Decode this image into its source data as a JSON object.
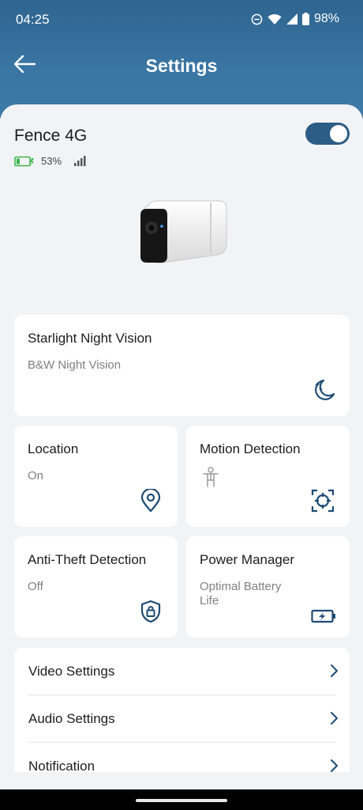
{
  "status_bar": {
    "time": "04:25",
    "battery": "98%"
  },
  "header": {
    "title": "Settings",
    "back_icon": "arrow-left-icon"
  },
  "device": {
    "name": "Fence 4G",
    "battery": "53%",
    "power_on": true,
    "accent": "#2d5c86"
  },
  "cards": {
    "night_vision": {
      "title": "Starlight Night Vision",
      "value": "B&W Night Vision",
      "icon": "moon-stars-icon"
    },
    "location": {
      "title": "Location",
      "value": "On",
      "icon": "map-pin-icon"
    },
    "motion": {
      "title": "Motion Detection",
      "icon": "crosshair-icon",
      "sub_icon": "person-icon"
    },
    "anti_theft": {
      "title": "Anti-Theft Detection",
      "value": "Off",
      "icon": "shield-lock-icon"
    },
    "power": {
      "title": "Power Manager",
      "value": "Optimal Battery Life",
      "icon": "battery-charging-icon"
    }
  },
  "settings_list": [
    {
      "label": "Video Settings"
    },
    {
      "label": "Audio Settings"
    },
    {
      "label": "Notification"
    }
  ]
}
